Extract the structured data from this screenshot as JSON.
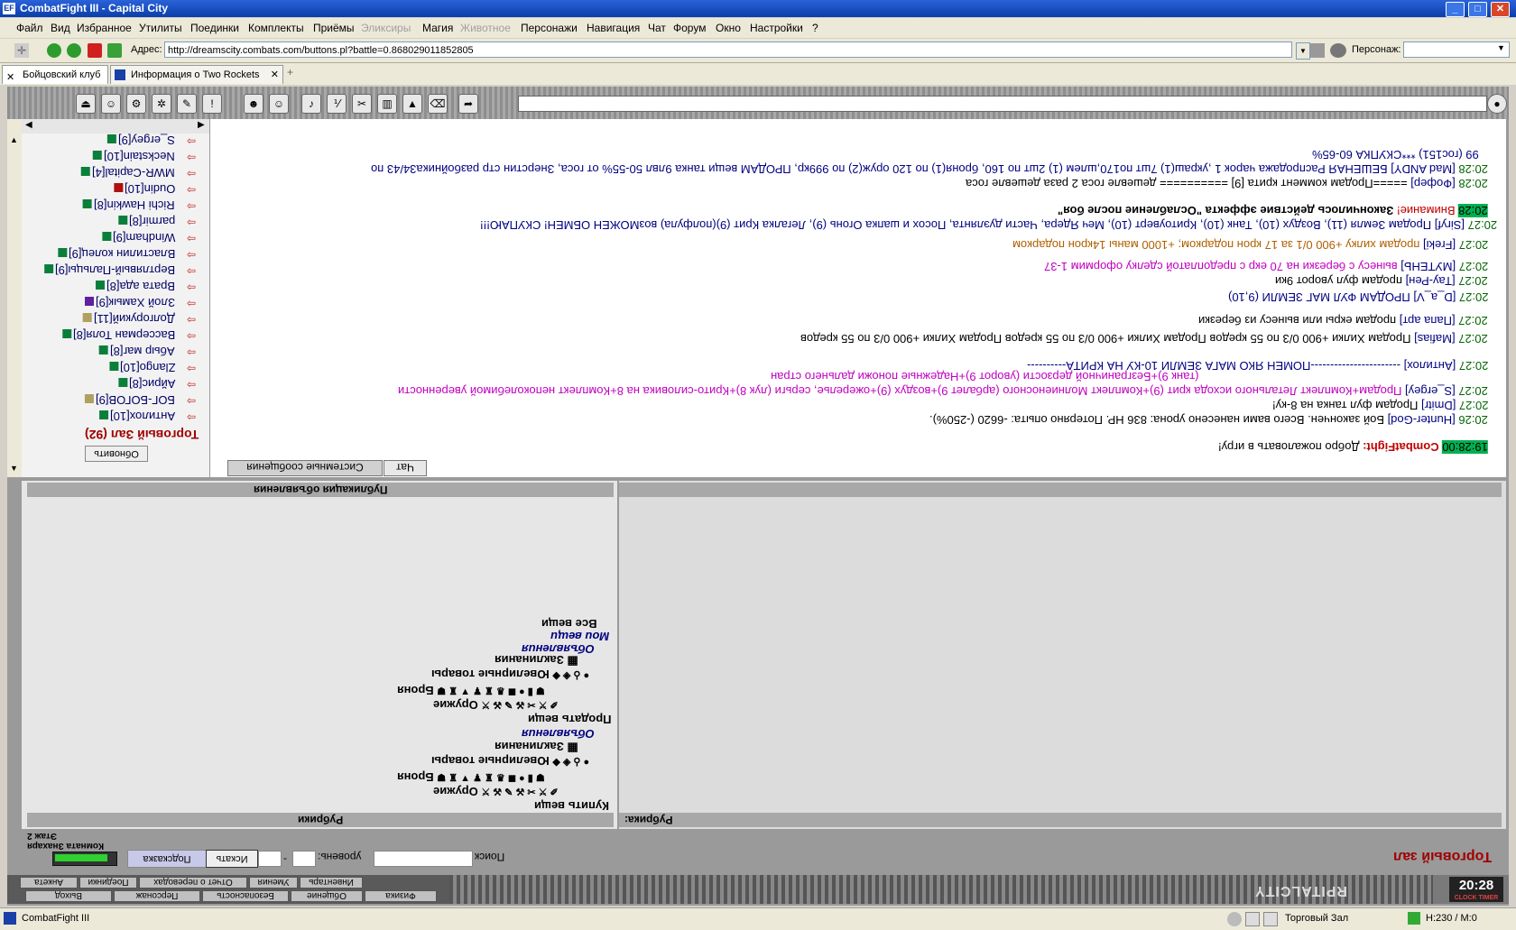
{
  "window": {
    "title": "CombatFight III - Capital City",
    "icon": "EF"
  },
  "menu": [
    "Файл",
    "Вид",
    "Избранное",
    "Утилиты",
    "Поединки",
    "Комплекты",
    "Приёмы",
    "Эликсиры",
    "Магия",
    "Животное",
    "Персонажи",
    "Навигация",
    "Чат",
    "Форум",
    "Окно",
    "Настройки",
    "?"
  ],
  "address": {
    "label": "Адрес:",
    "url": "http://dreamscity.combats.com/buttons.pl?battle=0.868029011852805",
    "char_label": "Персонаж:"
  },
  "tabs": [
    {
      "label": "Бойцовский клуб"
    },
    {
      "label": "Информация о Two Rockets"
    }
  ],
  "online": [
    {
      "name": "S_ergey[9]"
    },
    {
      "name": "Neckstain[10]"
    },
    {
      "name": "MWR-Capital[4]"
    },
    {
      "name": "Oudin[10]"
    },
    {
      "name": "Richi Hawkin[8]"
    },
    {
      "name": "parmir[8]"
    },
    {
      "name": "Windham[9]"
    },
    {
      "name": "Властилин колец[9]"
    },
    {
      "name": "Вертлявый-Пальцы[9]"
    },
    {
      "name": "Врата ада[8]"
    },
    {
      "name": "Злой Хамык[9]"
    },
    {
      "name": "Долгорукий[11]"
    },
    {
      "name": "Вассерман Толя[8]"
    },
    {
      "name": "Абыр маг[8]"
    },
    {
      "name": "Zlango[10]"
    },
    {
      "name": "Айрис[8]"
    },
    {
      "name": "БОГ-БОГОВ[9]"
    },
    {
      "name": "Антилох[10]"
    }
  ],
  "online_header": "Торговый Зал (92)",
  "online_refresh": "Обновить",
  "chat": [
    {
      "time": "99 (гос151) ***СКУПКА 60-65%",
      "nick": "",
      "text": "",
      "style": "navy"
    },
    {
      "time": "20:28",
      "nick": "[Mad ANDY]",
      "text": "БЕШЕНАЯ Распродажа чарок 1 ,украш(1) 7шт по170,шлем (1) 2шт по 160, броня(1) по 120 оруж(2) по 999кр, ПРОДАМ вещи танка 9лвл 50-55% от госа, Знерстин стр разбойника34/43 по",
      "style": "navy"
    },
    {
      "time": "20:28",
      "nick": "[Фофер]",
      "text": "=====Продам коммент крита [9] ========== дешевле госа      2 раза дешевле госа",
      "style": ""
    },
    {
      "time": "20:28",
      "nick": "Внимание!",
      "text": "Закончилось действие эффекта \"Ослабление после боя\"",
      "style": "red",
      "hl": true
    },
    {
      "time": "20:27",
      "nick": "[Siryf]",
      "text": "Продам Земля (11), Воздух (10), Танк (10), Критоуверт (10), Меч Ядера, Части дуэлянта, Посох и шапка Огонь (9), Легалка Крит (9)(полфула)   возМОЖЕН ОБМЕН! СКУПАЮ!!!",
      "style": "navy"
    },
    {
      "time": "20:27",
      "nick": "[Freki]",
      "text": "продам хилку +900 0/1 за 17 крон подарком; +1000 маны 14крон подарком",
      "style": "orange"
    },
    {
      "time": "20:27",
      "nick": "[МУТЕНЬ]",
      "text": "вынесу с березки на 70 екр с предоплатой сделку оформим 1-37",
      "style": "pink"
    },
    {
      "time": "20:27",
      "nick": "[Тау-Рен]",
      "text": "продам фул уворот 9ки",
      "style": ""
    },
    {
      "time": "20:27",
      "nick": "[D_a_V]",
      "text": "ПРОДАМ ФУЛ МАГ ЗЕМЛИ (9,10)",
      "style": "navy"
    },
    {
      "time": "20:27",
      "nick": "[Папа арт]",
      "text": "продам екры или вынесу из березки",
      "style": ""
    },
    {
      "time": "20:27",
      "nick": "[Мafias]",
      "text": "Продам Хилки +900 0/3 по 55 кредов    Продам Хилки +900 0/3 по 55 кредов    Продам Хилки +900 0/3 по 55 кредов",
      "style": ""
    },
    {
      "time": "20:27",
      "nick": "[Антилох]",
      "text": "-----------------------ПОМЕН ЯКО МАГА ЗЕМЛИ 10-КУ НА КРИТА----------",
      "style": ""
    },
    {
      "time": "20:27",
      "nick": "[S_ergey]",
      "text": "Продам+Комплект Летального исхода крит (9)+Комплект Молниеносного (арбалет 9)+воздух (9)+ожерелье, серьги (лук 8)+Крито-силовика на 8+Комплект непоколебимой уверенности",
      "style": "pink"
    },
    {
      "time": "",
      "nick": "",
      "text": "(танк 9)+Безграничной дерзости (уворот 9)+Надежные поножи дальнего стран",
      "style": "pink"
    },
    {
      "time": "20:27",
      "nick": "[Dmitr]",
      "text": "Продам фул танка на 8-ку!",
      "style": ""
    },
    {
      "time": "20:26",
      "nick": "[Hunter-God]",
      "text": "Бой закончен. Всего вами нанесено урона: 836 HP. Потеряно опыта: -6620 (-250%).",
      "style": ""
    },
    {
      "time": "19:28:00",
      "nick": "CombatFight:",
      "text": "Добро пожаловать в игру!",
      "style": "red",
      "hl": true
    }
  ],
  "chat_tabs": [
    {
      "label": "Чат"
    },
    {
      "label": "Системные сообщения"
    }
  ],
  "rubric_header": "Рубрики",
  "ads_header": "Публикация объявления",
  "rubric_label": "Рубрика:",
  "rubrics_buy": [
    "Купить вещи",
    "Оружие",
    "Броня",
    "Ювелирные товары",
    "Заклинания",
    "Объявления"
  ],
  "rubrics_sell": [
    "Продать вещи",
    "Оружие",
    "Броня",
    "Ювелирные товары",
    "Заклинания",
    "Объявления",
    "Мои вещи",
    "Все вещи"
  ],
  "hall_title": "Торговый зал",
  "search": {
    "label": "Поиск",
    "level_label": "уровень:",
    "dash": "-",
    "search_btn": "Искать",
    "hint_btn": "Подсказка"
  },
  "rooms": [
    "Комната Знахаря",
    "Этаж 2"
  ],
  "bottom_buttons": [
    "Инвентарь",
    "Умения",
    "Отчет о переводах",
    "Поединки",
    "Анкета"
  ],
  "bottom_buttons2": [
    "Общение",
    "Безопасность",
    "Персонаж",
    "Выход",
    "Физика"
  ],
  "clock": "20:28",
  "clock_label": "CLOCK TIMER",
  "brand": "RPITALCITY",
  "status": {
    "app": "CombatFight III",
    "room": "Торговый Зал",
    "hp": "H:230 / M:0"
  },
  "colors": {
    "titlebar": "#0a3ea8",
    "pink": "#c000c0",
    "navy": "#000080",
    "time": "#006400"
  }
}
